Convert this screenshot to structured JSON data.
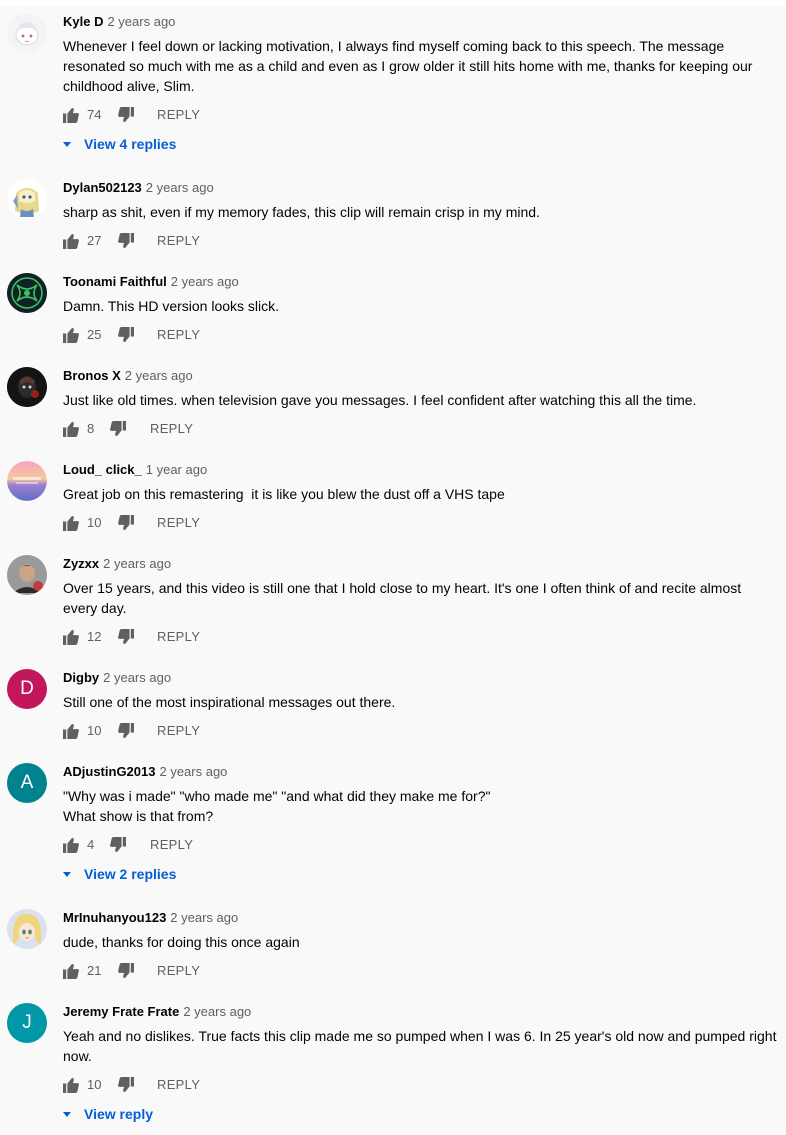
{
  "colors": {
    "link": "#065fd4",
    "meta": "#606060",
    "text": "#030303",
    "avatar_digby": "#c2185b",
    "avatar_adjustin": "#00838f",
    "avatar_jeremy": "#0097a7"
  },
  "ui": {
    "reply_label": "REPLY",
    "like_icon": "thumb-up-icon",
    "dislike_icon": "thumb-down-icon"
  },
  "comments": [
    {
      "author": "Kyle D",
      "time": "2 years ago",
      "text": "Whenever I feel down or lacking motivation, I always find myself coming back to this speech. The message resonated so much with me as a child and even as I grow older it still hits home with me, thanks for keeping our childhood alive, Slim.",
      "likes": "74",
      "replies_label": "View 4 replies"
    },
    {
      "author": "Dylan502123",
      "time": "2 years ago",
      "text": "sharp as shit, even if my memory fades, this clip will remain crisp in my mind.",
      "likes": "27"
    },
    {
      "author": "Toonami Faithful",
      "time": "2 years ago",
      "text": "Damn. This HD version looks slick.",
      "likes": "25"
    },
    {
      "author": "Bronos X",
      "time": "2 years ago",
      "text": "Just like old times. when television gave you messages. I feel confident after watching this all the time.",
      "likes": "8"
    },
    {
      "author": "Loud_ click_",
      "time": "1 year ago",
      "text": "Great job on this remastering  it is like you blew the dust off a VHS tape",
      "likes": "10"
    },
    {
      "author": "Zyzxx",
      "time": "2 years ago",
      "text": "Over 15 years, and this video is still one that I hold close to my heart. It's one I often think of and recite almost every day.",
      "likes": "12"
    },
    {
      "author": "Digby",
      "time": "2 years ago",
      "text": "Still one of the most inspirational messages out there.",
      "likes": "10",
      "avatar_letter": "D"
    },
    {
      "author": "ADjustinG2013",
      "time": "2 years ago",
      "text": "\"Why was i made\" \"who made me\" \"and what did they make me for?\"",
      "text2": "What show is that from?",
      "likes": "4",
      "replies_label": "View 2 replies",
      "avatar_letter": "A"
    },
    {
      "author": "MrInuhanyou123",
      "time": "2 years ago",
      "text": "dude, thanks for doing this once again",
      "likes": "21"
    },
    {
      "author": "Jeremy Frate Frate",
      "time": "2 years ago",
      "text": "Yeah and no dislikes. True facts this clip made me so pumped when I was 6. In 25 year's old now and pumped right now.",
      "likes": "10",
      "replies_label": "View reply",
      "avatar_letter": "J"
    }
  ]
}
